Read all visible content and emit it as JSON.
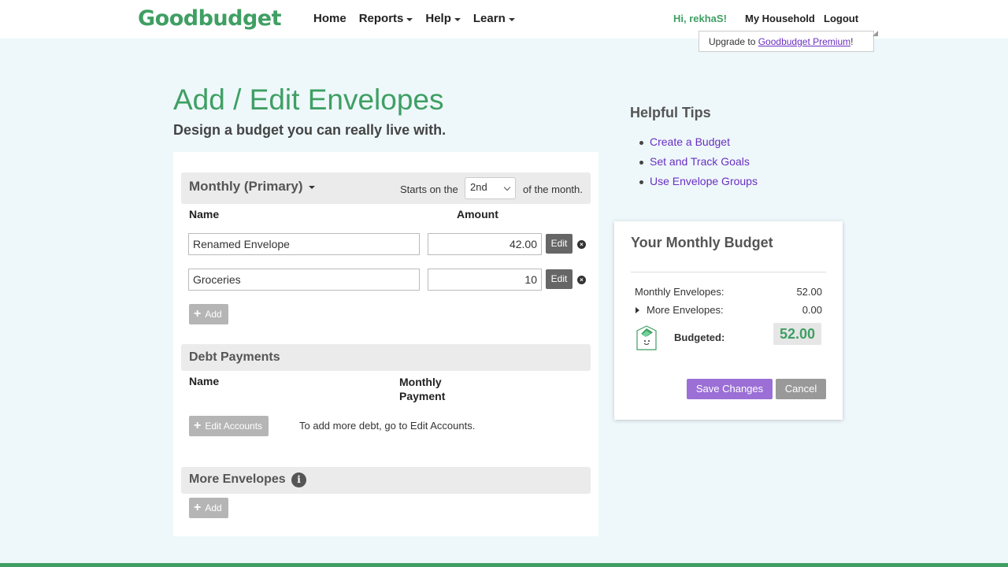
{
  "header": {
    "logo": "Goodbudget",
    "nav": [
      {
        "label": "Home",
        "dropdown": false
      },
      {
        "label": "Reports",
        "dropdown": true
      },
      {
        "label": "Help",
        "dropdown": true
      },
      {
        "label": "Learn",
        "dropdown": true
      }
    ],
    "greeting": "Hi, rekhaS!",
    "household": "My Household",
    "logout": "Logout",
    "upgrade_prefix": "Upgrade to ",
    "upgrade_link": "Goodbudget Premium",
    "upgrade_suffix": "!"
  },
  "page": {
    "title": "Add / Edit Envelopes",
    "subtitle": "Design a budget you can really live with."
  },
  "monthly": {
    "title": "Monthly (Primary)",
    "starts_prefix": "Starts on the",
    "start_day": "2nd",
    "starts_suffix": "of the month.",
    "col_name": "Name",
    "col_amount": "Amount",
    "envelopes": [
      {
        "name": "Renamed Envelope",
        "amount": "42.00",
        "edit_label": "Edit"
      },
      {
        "name": "Groceries",
        "amount": "10",
        "edit_label": "Edit"
      }
    ],
    "add_label": "Add"
  },
  "debt": {
    "title": "Debt Payments",
    "col_name": "Name",
    "col_payment_line1": "Monthly",
    "col_payment_line2": "Payment",
    "edit_accounts_label": "Edit Accounts",
    "note": "To add more debt, go to Edit Accounts."
  },
  "more": {
    "title": "More Envelopes",
    "info_glyph": "i",
    "add_label": "Add"
  },
  "tips": {
    "title": "Helpful Tips",
    "items": [
      "Create a Budget",
      "Set and Track Goals",
      "Use Envelope Groups"
    ]
  },
  "budget": {
    "title": "Your Monthly Budget",
    "monthly_label": "Monthly Envelopes:",
    "monthly_value": "52.00",
    "more_label": "More Envelopes:",
    "more_value": "0.00",
    "budgeted_label": "Budgeted:",
    "budgeted_value": "52.00",
    "save_label": "Save Changes",
    "cancel_label": "Cancel"
  },
  "colors": {
    "brand_green": "#3f9f63",
    "link_purple": "#6a2fc2",
    "save_purple": "#9b6fd6",
    "background": "#eef8fb"
  }
}
